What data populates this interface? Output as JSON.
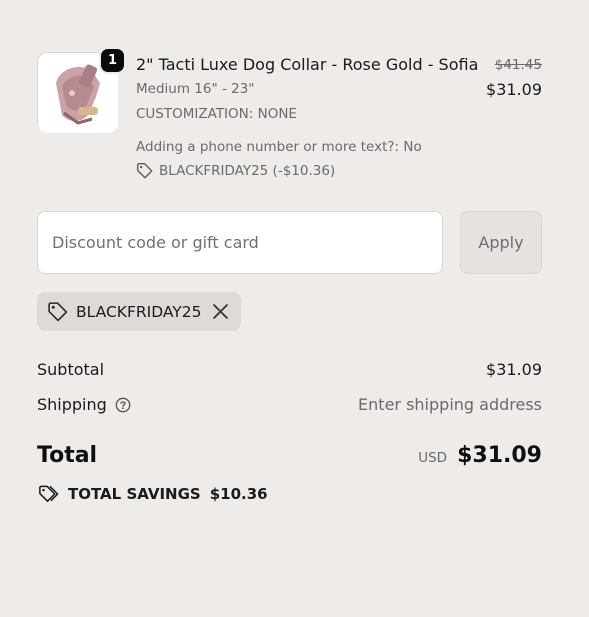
{
  "cart_item": {
    "quantity": "1",
    "title": "2\" Tacti Luxe Dog Collar - Rose Gold - Sofia",
    "variant": "Medium 16\" - 23\"",
    "customization": "CUSTOMIZATION: NONE",
    "phone_option": "Adding a phone number or more text?: No",
    "discount_line": "BLACKFRIDAY25 (-$10.36)",
    "original_price": "$41.45",
    "price": "$31.09",
    "image_icon": "dog-collar-photo"
  },
  "discount": {
    "placeholder": "Discount code or gift card",
    "value": "",
    "apply_label": "Apply"
  },
  "applied_code": {
    "label": "BLACKFRIDAY25",
    "tag_icon": "tag-icon",
    "remove_icon": "close-icon"
  },
  "summary": {
    "subtotal_label": "Subtotal",
    "subtotal_value": "$31.09",
    "shipping_label": "Shipping",
    "shipping_value": "Enter shipping address",
    "total_label": "Total",
    "currency": "USD",
    "total_value": "$31.09",
    "savings_label": "TOTAL SAVINGS",
    "savings_value": "$10.36"
  },
  "colors": {
    "background": "#eeebe9",
    "text": "#1b1b1b",
    "muted": "#6b6b6b",
    "badge": "#0b0b0b"
  }
}
